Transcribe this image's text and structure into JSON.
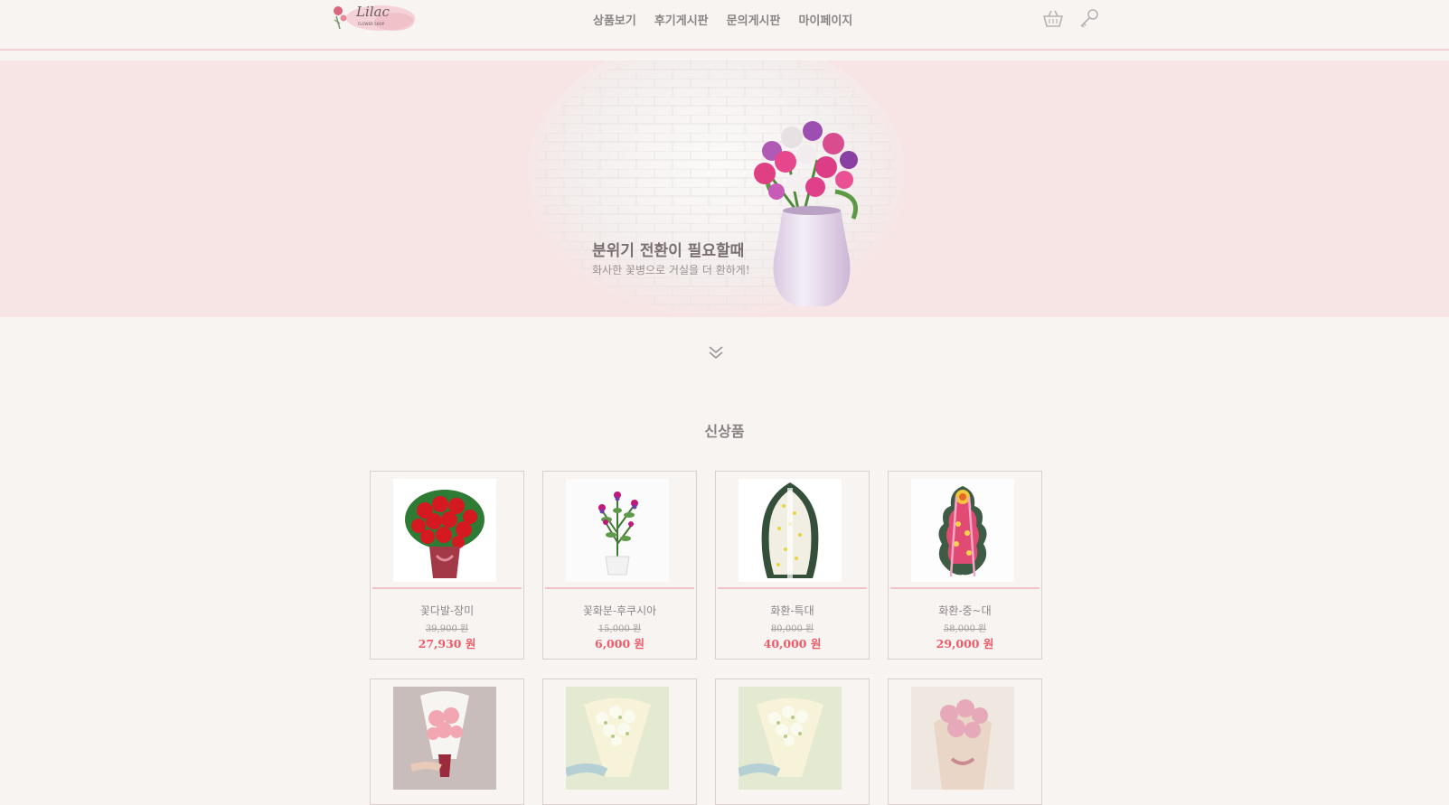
{
  "header": {
    "logo_text": "Lilac",
    "logo_sub": "FLOWER SHOP",
    "nav": [
      "상품보기",
      "후기게시판",
      "문의게시판",
      "마이페이지"
    ],
    "icons": [
      "basket-icon",
      "key-icon"
    ]
  },
  "banner": {
    "title": "분위기 전환이 필요할때",
    "subtitle": "화사한 꽃병으로 거실을 더 환하게!"
  },
  "section": {
    "title": "신상품"
  },
  "products": [
    {
      "name": "꽃다발-장미",
      "old_price": "39,900 원",
      "price": "27,930 원",
      "image": "red-rose-bouquet"
    },
    {
      "name": "꽃화분-후쿠시아",
      "old_price": "15,000 원",
      "price": "6,000 원",
      "image": "fuchsia-pot"
    },
    {
      "name": "화환-특대",
      "old_price": "80,000 원",
      "price": "40,000 원",
      "image": "funeral-wreath-large"
    },
    {
      "name": "화환-중~대",
      "old_price": "58,000 원",
      "price": "29,000 원",
      "image": "celebration-wreath"
    },
    {
      "name": "",
      "old_price": "",
      "price": "",
      "image": "pink-carnation-bouquet"
    },
    {
      "name": "",
      "old_price": "",
      "price": "",
      "image": "babys-breath-bouquet"
    },
    {
      "name": "",
      "old_price": "",
      "price": "",
      "image": "babys-breath-bouquet"
    },
    {
      "name": "",
      "old_price": "",
      "price": "",
      "image": "pink-rose-bouquet"
    }
  ],
  "colors": {
    "background": "#f8f4f2",
    "banner": "#f7e4e4",
    "accent": "#ef5b68",
    "divider": "#f1c3c7"
  }
}
